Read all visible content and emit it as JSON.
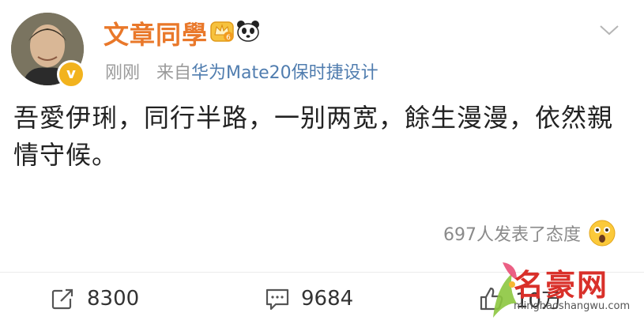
{
  "post": {
    "username": "文章同學",
    "level_badge": "6",
    "verified_mark": "v",
    "timestamp": "刚刚",
    "source_prefix": "来自",
    "device": "华为Mate20保时捷设计",
    "content_line1": "吾愛伊琍，同行半路，一别两宽，餘生漫漫，依然親",
    "content_line2": "情守候。",
    "reaction_text": "697人发表了态度"
  },
  "actions": {
    "repost_count": "8300",
    "comment_count": "9684",
    "like_count": "10万"
  },
  "watermark": {
    "brand": "名豪网",
    "url": "minghaoshangwu.com"
  },
  "icons": {
    "crown": "crown-badge-icon",
    "panda": "panda-icon",
    "chevron": "chevron-down-icon",
    "emoji": "surprised-emoji-icon",
    "repost": "share-icon",
    "comment": "comment-icon",
    "like": "like-icon"
  },
  "colors": {
    "username": "#e9782a",
    "device_link": "#507daf",
    "meta": "#9b9b9b",
    "verified": "#f2b31e",
    "watermark": "#d9302a"
  }
}
